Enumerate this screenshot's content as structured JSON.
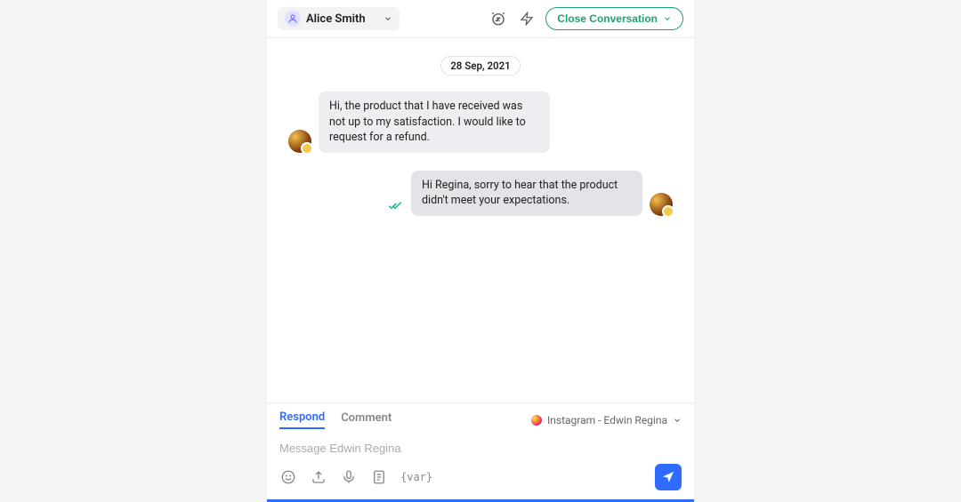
{
  "header": {
    "assignee_name": "Alice Smith",
    "close_label": "Close Conversation"
  },
  "conversation": {
    "date_label": "28 Sep, 2021",
    "messages": [
      {
        "side": "left",
        "text": "Hi, the product that I have received was not up to my satisfaction. I would like to request for a refund."
      },
      {
        "side": "right",
        "text": "Hi Regina, sorry to hear that the product didn't meet your expectations."
      }
    ]
  },
  "composer": {
    "tabs": {
      "respond": "Respond",
      "comment": "Comment"
    },
    "channel_label": "Instagram - Edwin Regina",
    "placeholder": "Message Edwin Regina",
    "var_label": "{var}"
  }
}
